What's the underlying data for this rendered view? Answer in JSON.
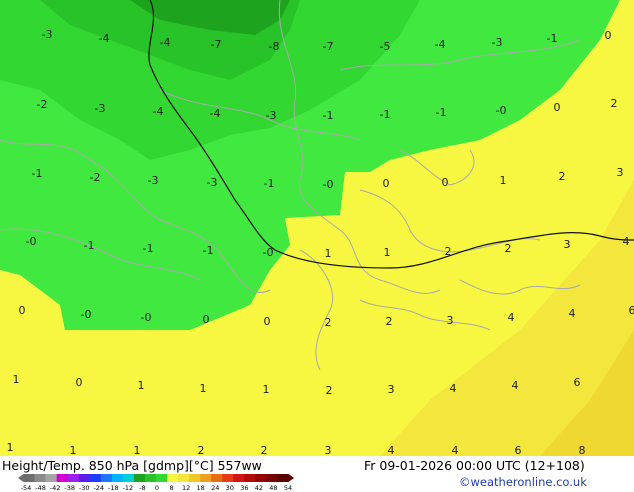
{
  "map": {
    "fill_colors": {
      "green_dark": "#1ea31e",
      "green_mid": "#28c328",
      "green": "#32d732",
      "green_light": "#40e840",
      "yellow": "#f7f742",
      "yellow_warm": "#f3e63c",
      "orange_warm": "#f0d832"
    },
    "contour_color": "#111111",
    "coast_color": "#a9a9a9",
    "labels": [
      {
        "v": "-3"
      },
      {
        "v": "-4"
      },
      {
        "v": "-4"
      },
      {
        "v": "-7"
      },
      {
        "v": "-8"
      },
      {
        "v": "-7"
      },
      {
        "v": "-5"
      },
      {
        "v": "-4"
      },
      {
        "v": "-3"
      },
      {
        "v": "-1"
      },
      {
        "v": "0"
      },
      {
        "v": "-2"
      },
      {
        "v": "-3"
      },
      {
        "v": "-4"
      },
      {
        "v": "-4"
      },
      {
        "v": "-3"
      },
      {
        "v": "-1"
      },
      {
        "v": "-1"
      },
      {
        "v": "-1"
      },
      {
        "v": "-0"
      },
      {
        "v": "0"
      },
      {
        "v": "2"
      },
      {
        "v": "-1"
      },
      {
        "v": "-2"
      },
      {
        "v": "-3"
      },
      {
        "v": "-3"
      },
      {
        "v": "-1"
      },
      {
        "v": "-0"
      },
      {
        "v": "0"
      },
      {
        "v": "0"
      },
      {
        "v": "1"
      },
      {
        "v": "2"
      },
      {
        "v": "3"
      },
      {
        "v": "-0"
      },
      {
        "v": "-1"
      },
      {
        "v": "-1"
      },
      {
        "v": "-1"
      },
      {
        "v": "-0"
      },
      {
        "v": "1"
      },
      {
        "v": "1"
      },
      {
        "v": "2"
      },
      {
        "v": "2"
      },
      {
        "v": "3"
      },
      {
        "v": "4"
      },
      {
        "v": "0"
      },
      {
        "v": "-0"
      },
      {
        "v": "-0"
      },
      {
        "v": "0"
      },
      {
        "v": "0"
      },
      {
        "v": "2"
      },
      {
        "v": "2"
      },
      {
        "v": "3"
      },
      {
        "v": "4"
      },
      {
        "v": "4"
      },
      {
        "v": "6"
      },
      {
        "v": "1"
      },
      {
        "v": "0"
      },
      {
        "v": "1"
      },
      {
        "v": "1"
      },
      {
        "v": "1"
      },
      {
        "v": "2"
      },
      {
        "v": "3"
      },
      {
        "v": "4"
      },
      {
        "v": "4"
      },
      {
        "v": "6"
      },
      {
        "v": "1"
      },
      {
        "v": "1"
      },
      {
        "v": "1"
      },
      {
        "v": "2"
      },
      {
        "v": "2"
      },
      {
        "v": "3"
      },
      {
        "v": "4"
      },
      {
        "v": "4"
      },
      {
        "v": "6"
      },
      {
        "v": "8"
      }
    ]
  },
  "footer": {
    "title": "Height/Temp. 850 hPa [gdmp][°C] 557ww",
    "datetime": "Fr 09-01-2026 00:00 UTC (12+108)",
    "credit": "©weatheronline.co.uk"
  },
  "scale": {
    "colors": [
      "#6e6e6e",
      "#8a8a8a",
      "#a5a5a5",
      "#d200d2",
      "#a020f0",
      "#5a1ee6",
      "#1e3cff",
      "#1e78ff",
      "#00b4ff",
      "#00d2d2",
      "#1ea31e",
      "#28c328",
      "#32d732",
      "#f7f742",
      "#f3e63c",
      "#f0c828",
      "#f0a01e",
      "#e66e14",
      "#e63c14",
      "#d21414",
      "#b40a0a",
      "#960000",
      "#780000",
      "#5a0000"
    ],
    "ticks": [
      "-54",
      "-48",
      "-42",
      "-38",
      "-30",
      "-24",
      "-18",
      "-12",
      "-8",
      "0",
      "8",
      "12",
      "18",
      "24",
      "30",
      "36",
      "42",
      "48",
      "54"
    ]
  }
}
